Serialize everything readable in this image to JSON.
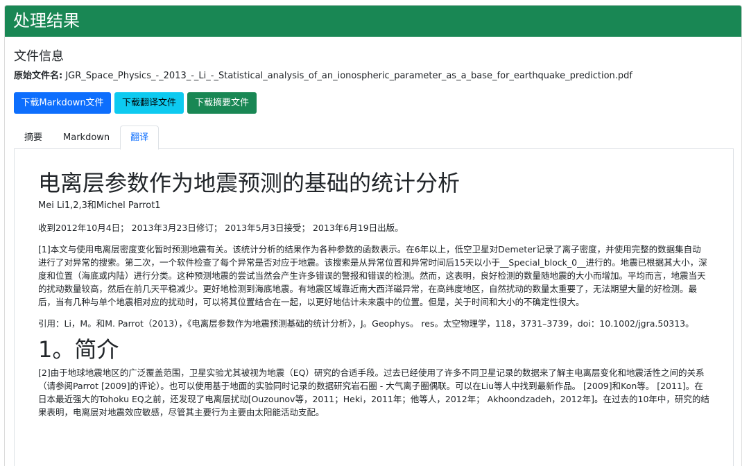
{
  "header": {
    "title": "处理结果"
  },
  "file_info": {
    "section_title": "文件信息",
    "orig_label": "原始文件名:",
    "orig_value": " JGR_Space_Physics_-_2013_-_Li_-_Statistical_analysis_of_an_ionospheric_parameter_as_a_base_for_earthquake_prediction.pdf"
  },
  "buttons": {
    "download_markdown": "下载Markdown文件",
    "download_translation": "下载翻译文件",
    "download_summary": "下载摘要文件"
  },
  "tabs": [
    {
      "label": "摘要"
    },
    {
      "label": "Markdown"
    },
    {
      "label": "翻译"
    }
  ],
  "colors": {
    "header_bg": "#198754",
    "primary": "#0d6efd",
    "info": "#0dcaf0",
    "success": "#198754"
  },
  "document": {
    "title": "电离层参数作为地震预测的基础的统计分析",
    "authors": "Mei Li1,2,3和Michel Parrot1",
    "received": "收到2012年10月4日； 2013年3月23日修订； 2013年5月3日接受； 2013年6月19日出版。",
    "abstract": "[1]本文与使用电离层密度变化暂时预测地震有关。该统计分析的结果作为各种参数的函数表示。在6年以上，低空卫星对Demeter记录了离子密度，并使用完整的数据集自动进行了对异常的搜索。第二次，一个软件检查了每个异常是否对应于地震。该搜索是从异常位置和异常时间后15天以小于__Special_block_0__进行的。地震已根据其大小，深度和位置（海底或内陆）进行分类。这种预测地震的尝试当然会产生许多错误的警报和错误的检测。然而，这表明，良好检测的数量随地震的大小而增加。平均而言，地震当天的扰动数量较高，然后在前几天平稳减少。更好地检测到海底地震。有地震区域靠近南大西洋磁异常，在高纬度地区，自然扰动的数量太重要了，无法期望大量的好检测。最后，当有几种与单个地震相对应的扰动时，可以将其位置结合在一起，以更好地估计未来震中的位置。但是，关于时间和大小的不确定性很大。",
    "citation": "引用：Li，M。和M. Parrot（2013），《电离层参数作为地震预测基础的统计分析》，J。Geophys。 res。太空物理学，118，3731–3739，doi：10.1002/jgra.50313。",
    "section1_title": "1。简介",
    "section1_p": "[2]由于地球地震地区的广泛覆盖范围，卫星实验尤其被视为地震（EQ）研究的合适手段。过去已经使用了许多不同卫星记录的数据来了解主电离层变化和地震活性之间的关系（请参阅Parrot [2009]的评论）。也可以使用基于地面的实验同时记录的数据研究岩石圈 - 大气离子圈偶联。可以在Liu等人中找到最新作品。 [2009]和Kon等。 [2011]。在日本最近强大的Tohoku EQ之前，还发现了电离层扰动[Ouzounov等，2011；Heki，2011年；他等人，2012年； Akhoondzadeh，2012年]。在过去的10年中，研究的结果表明，电离层对地震效应敏感，尽管其主要行为主要由太阳能活动支配。"
  }
}
